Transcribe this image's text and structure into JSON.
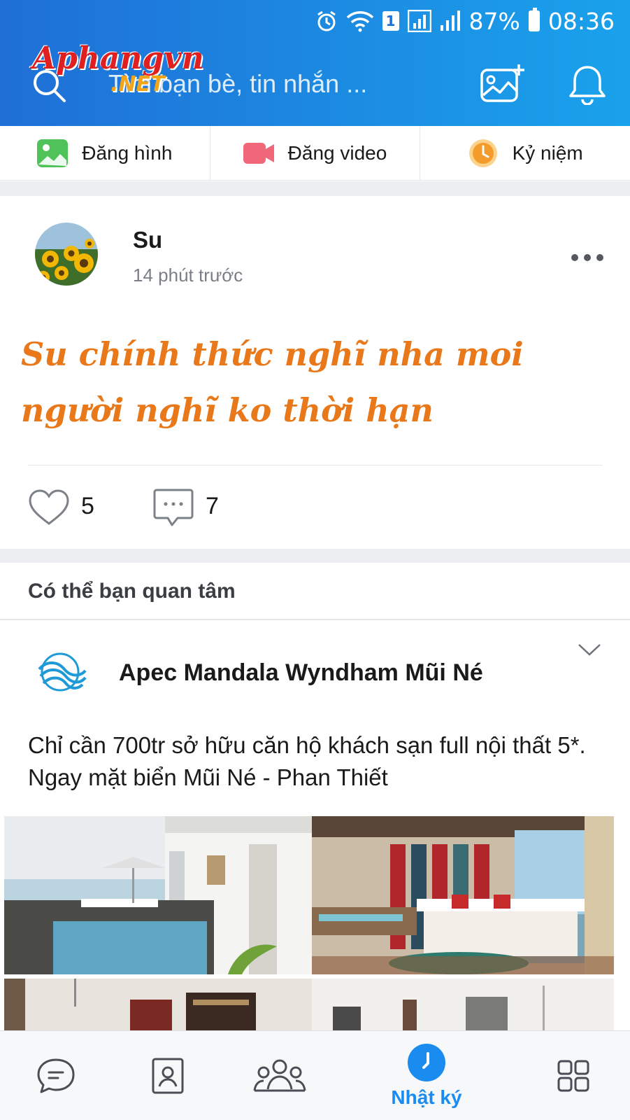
{
  "status_bar": {
    "battery": "87%",
    "time": "08:36",
    "sim_slot": "1"
  },
  "watermark": {
    "top": "Aphangvn",
    "bottom": ".NET"
  },
  "search": {
    "placeholder": "Tìm bạn bè, tin nhắn ..."
  },
  "quick_actions": [
    {
      "label": "Đăng hình",
      "icon": "photo-icon"
    },
    {
      "label": "Đăng video",
      "icon": "video-icon"
    },
    {
      "label": "Kỷ niệm",
      "icon": "clock-memory-icon"
    }
  ],
  "post": {
    "author": "Su",
    "time": "14 phút trước",
    "text": "Su chính thức nghĩ nha moi người nghĩ ko thời hạn",
    "likes": "5",
    "comments": "7"
  },
  "suggestions": {
    "title": "Có thể bạn quan tâm",
    "ad": {
      "name": "Apec Mandala Wyndham Mũi Né",
      "text": "Chỉ cần 700tr sở hữu căn hộ khách sạn full nội thất 5*. Ngay mặt biển Mũi Né - Phan Thiết"
    }
  },
  "bottom_nav": {
    "items": [
      {
        "icon": "chat-icon"
      },
      {
        "icon": "contacts-icon"
      },
      {
        "icon": "groups-icon"
      },
      {
        "icon": "timeline-icon",
        "label": "Nhật ký",
        "active": true
      },
      {
        "icon": "more-apps-icon"
      }
    ]
  },
  "colors": {
    "header_start": "#1f6fd6",
    "header_end": "#1aa2ec",
    "accent": "#1a8cef",
    "post_text": "#e8781a"
  }
}
